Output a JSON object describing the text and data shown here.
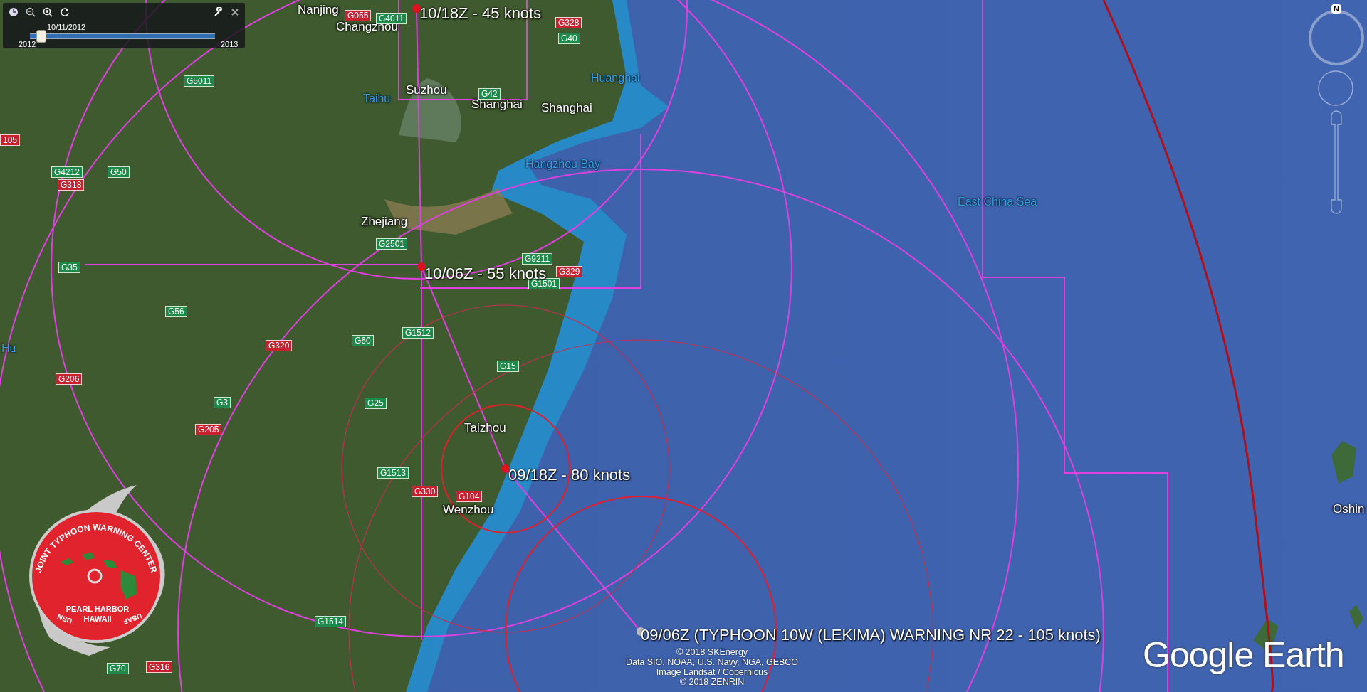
{
  "time_slider": {
    "date": "10/11/2012",
    "start": "2012",
    "end": "2013",
    "level": 0.06
  },
  "places": [
    {
      "name": "Nanjing",
      "kind": "city"
    },
    {
      "name": "Changzhou",
      "kind": "city"
    },
    {
      "name": "Suzhou",
      "kind": "city"
    },
    {
      "name": "Shanghai",
      "kind": "city"
    },
    {
      "name": "Shanghai",
      "kind": "city"
    },
    {
      "name": "Taihu",
      "kind": "water"
    },
    {
      "name": "Huanghai",
      "kind": "water"
    },
    {
      "name": "Hangzhou Bay",
      "kind": "water"
    },
    {
      "name": "East China Sea",
      "kind": "water"
    },
    {
      "name": "Zhejiang",
      "kind": "city"
    },
    {
      "name": "Taizhou",
      "kind": "city"
    },
    {
      "name": "Wenzhou",
      "kind": "city"
    },
    {
      "name": "Hu",
      "kind": "water"
    },
    {
      "name": "Oshin",
      "kind": "city"
    }
  ],
  "road_shields": [
    {
      "label": "G4011",
      "kind": "expressway"
    },
    {
      "label": "G40",
      "kind": "expressway"
    },
    {
      "label": "G42",
      "kind": "expressway"
    },
    {
      "label": "G5011",
      "kind": "expressway"
    },
    {
      "label": "G4212",
      "kind": "expressway"
    },
    {
      "label": "G50",
      "kind": "expressway"
    },
    {
      "label": "G2501",
      "kind": "expressway"
    },
    {
      "label": "G9211",
      "kind": "expressway"
    },
    {
      "label": "G1501",
      "kind": "expressway"
    },
    {
      "label": "G35",
      "kind": "expressway"
    },
    {
      "label": "G56",
      "kind": "expressway"
    },
    {
      "label": "G60",
      "kind": "expressway"
    },
    {
      "label": "G1512",
      "kind": "expressway"
    },
    {
      "label": "G15",
      "kind": "expressway"
    },
    {
      "label": "G25",
      "kind": "expressway"
    },
    {
      "label": "G3",
      "kind": "expressway"
    },
    {
      "label": "G1513",
      "kind": "expressway"
    },
    {
      "label": "G1514",
      "kind": "expressway"
    },
    {
      "label": "G70",
      "kind": "expressway"
    },
    {
      "label": "G055",
      "kind": "national"
    },
    {
      "label": "G328",
      "kind": "national"
    },
    {
      "label": "G318",
      "kind": "national"
    },
    {
      "label": "105",
      "kind": "national"
    },
    {
      "label": "G329",
      "kind": "national"
    },
    {
      "label": "G320",
      "kind": "national"
    },
    {
      "label": "G206",
      "kind": "national"
    },
    {
      "label": "G205",
      "kind": "national"
    },
    {
      "label": "G330",
      "kind": "national"
    },
    {
      "label": "G104",
      "kind": "national"
    },
    {
      "label": "G316",
      "kind": "national"
    }
  ],
  "track_points": [
    {
      "label": "10/18Z - 45 knots"
    },
    {
      "label": "10/06Z - 55 knots"
    },
    {
      "label": "09/18Z - 80 knots"
    },
    {
      "label": "09/06Z (TYPHOON 10W (LEKIMA) WARNING NR 22    - 105 knots)"
    }
  ],
  "attribution": [
    "© 2018 SKEnergy",
    "Data SIO, NOAA, U.S. Navy, NGA, GEBCO",
    "Image Landsat / Copernicus",
    "© 2018 ZENRIN"
  ],
  "logo": "Google Earth",
  "compass": {
    "north": "N"
  },
  "emblem": {
    "title": "JOINT TYPHOON WARNING CENTER",
    "location": [
      "PEARL HARBOR",
      "HAWAII"
    ],
    "left": "USN",
    "right": "USAF"
  }
}
